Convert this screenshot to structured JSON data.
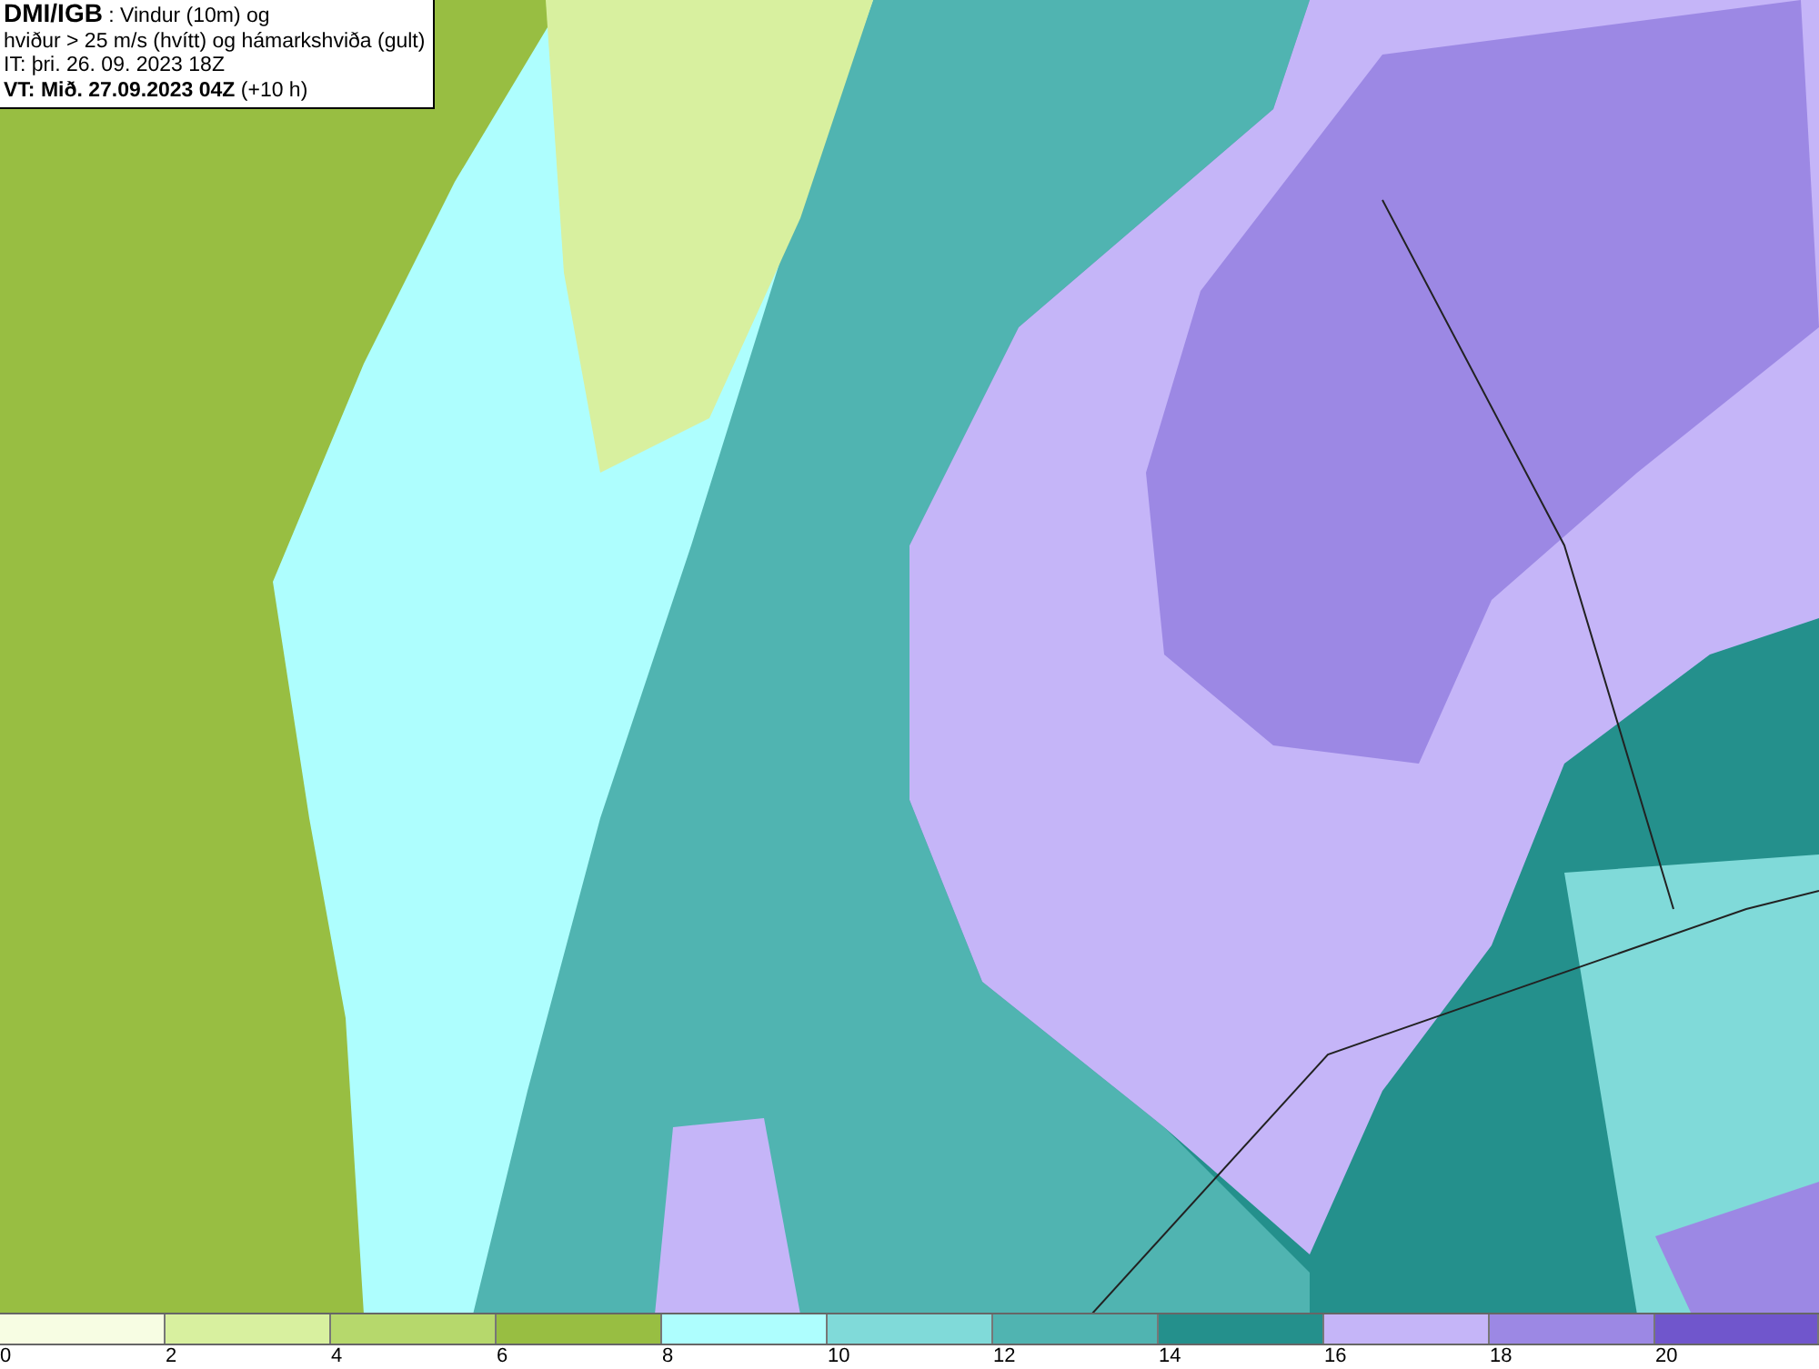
{
  "header": {
    "lines": [
      "**DMI/IGB** : Vindur (10m) og",
      "hviður > 25 m/s (hvítt) og hámarkshviða (gult)",
      "IT: þri. 26. 09. 2023 18Z",
      "**VT: Mið. 27.09.2023 04Z** (+10 h)"
    ]
  },
  "legend": [
    {
      "label": "0",
      "color": "#f7fde3"
    },
    {
      "label": "2",
      "color": "#d8f09f"
    },
    {
      "label": "4",
      "color": "#b6d86c"
    },
    {
      "label": "6",
      "color": "#98be42"
    },
    {
      "label": "8",
      "color": "#aefefe"
    },
    {
      "label": "10",
      "color": "#80dad9"
    },
    {
      "label": "12",
      "color": "#50b4b1"
    },
    {
      "label": "14",
      "color": "#24908c"
    },
    {
      "label": "16",
      "color": "#c5b5f8"
    },
    {
      "label": "18",
      "color": "#9c88e4"
    },
    {
      "label": "20",
      "color": "#7056cc"
    }
  ]
}
